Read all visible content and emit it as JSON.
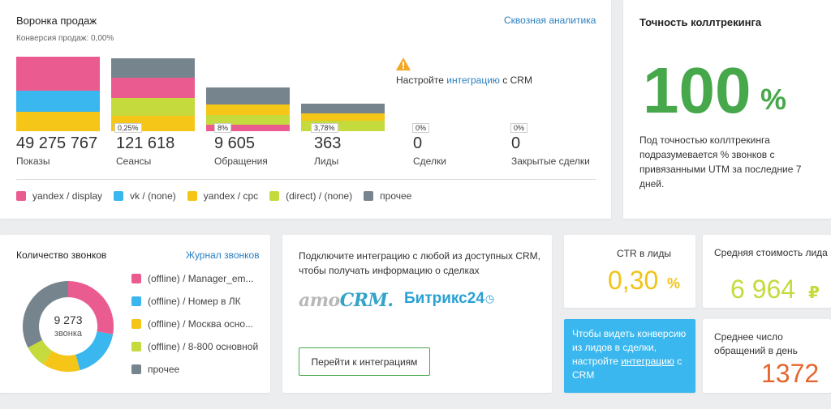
{
  "funnel": {
    "title": "Воронка продаж",
    "conversion": "Конверсия продаж: 0,00%",
    "link": "Сквозная аналитика",
    "crm_notice": {
      "prefix": "Настройте ",
      "link": "интеграцию",
      "suffix": " с CRM"
    },
    "stages": [
      {
        "value": "49 275 767",
        "label": "Показы",
        "pct": ""
      },
      {
        "value": "121 618",
        "label": "Сеансы",
        "pct": "0,25%"
      },
      {
        "value": "9 605",
        "label": "Обращения",
        "pct": "8%"
      },
      {
        "value": "363",
        "label": "Лиды",
        "pct": "3,78%"
      },
      {
        "value": "0",
        "label": "Сделки",
        "pct": "0%"
      },
      {
        "value": "0",
        "label": "Закрытые сделки",
        "pct": "0%"
      }
    ],
    "legend": [
      {
        "label": "yandex / display",
        "color": "#ea5c8f"
      },
      {
        "label": "vk / (none)",
        "color": "#3ab7ee"
      },
      {
        "label": "yandex / cpc",
        "color": "#f5c518"
      },
      {
        "label": "(direct) / (none)",
        "color": "#c5da3c"
      },
      {
        "label": "прочее",
        "color": "#76848d"
      }
    ]
  },
  "accuracy": {
    "title": "Точность коллтрекинга",
    "value": "100",
    "unit": "%",
    "description": "Под точностью коллтрекинга подразумевается % звонков с привязанными UTM за последние 7 дней."
  },
  "calls": {
    "title": "Количество звонков",
    "link": "Журнал звонков",
    "total": "9 273",
    "total_label": "звонка",
    "legend": [
      {
        "label": "(offline) / Manager_em...",
        "color": "#ea5c8f"
      },
      {
        "label": "(offline) / Номер в ЛК",
        "color": "#3ab7ee"
      },
      {
        "label": "(offline) / Москва осно...",
        "color": "#f5c518"
      },
      {
        "label": "(offline) / 8-800 основной",
        "color": "#c5da3c"
      },
      {
        "label": "прочее",
        "color": "#76848d"
      }
    ]
  },
  "crm": {
    "text": "Подключите интеграцию с любой из доступных CRM, чтобы получать информацию о сделках",
    "amo_a": "amo",
    "amo_b": "CRM.",
    "bitrix": "Битрикс24",
    "button": "Перейти к интеграциям"
  },
  "ctr": {
    "title": "CTR в лиды",
    "value": "0,30",
    "unit": "%",
    "color": "#f0c419"
  },
  "cost": {
    "title": "Средняя стоимость лида",
    "value": "6 964",
    "unit": "₽",
    "color": "#c5da3c"
  },
  "conv": {
    "prefix": "Чтобы видеть конверсию из лидов в сделки, настройте ",
    "link": "интеграцию",
    "suffix": " с CRM"
  },
  "avg": {
    "title": "Среднее число обращений в день",
    "value": "1372",
    "color": "#e3672f"
  }
}
